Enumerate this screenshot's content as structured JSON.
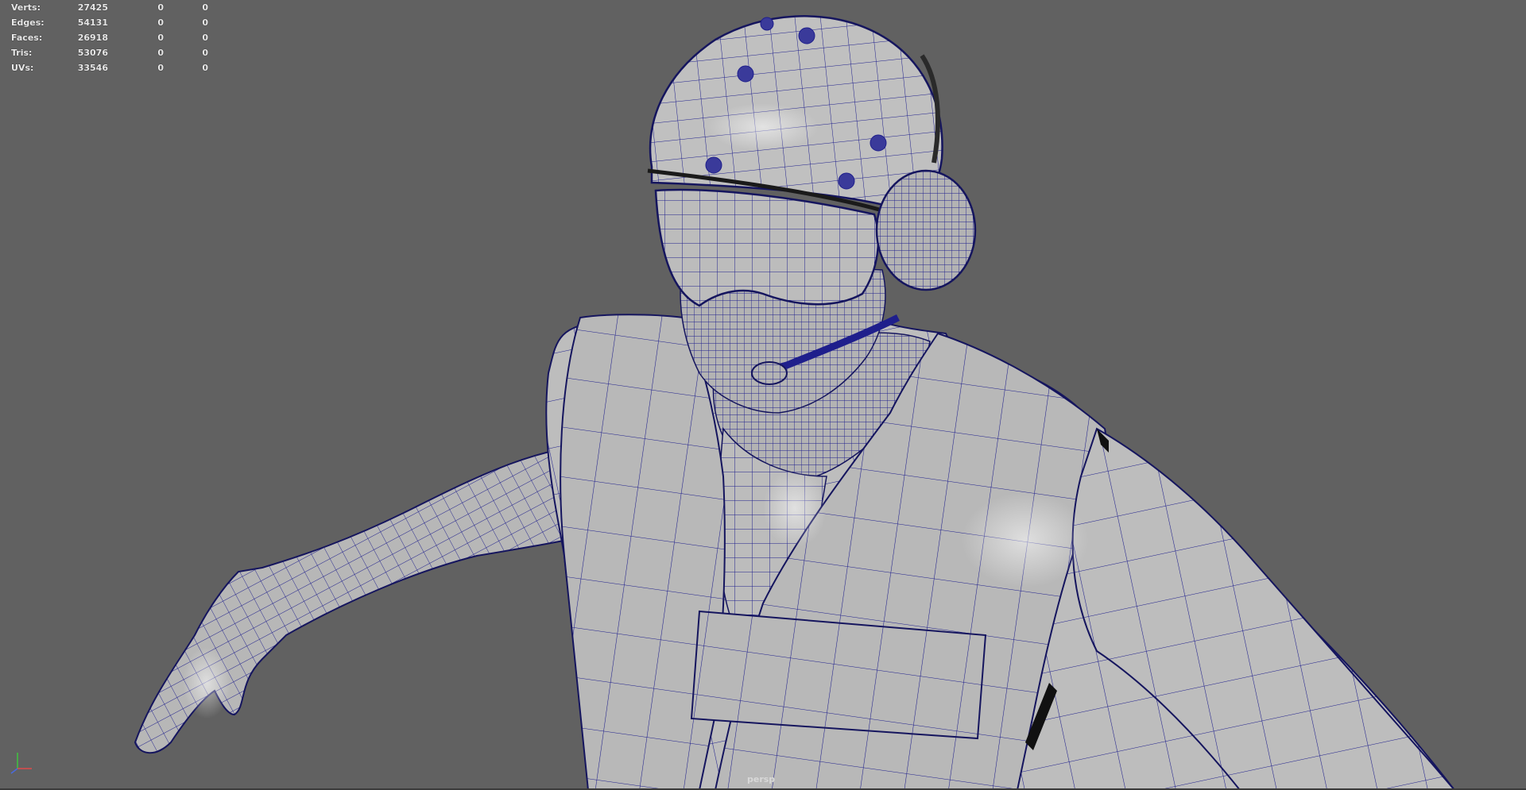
{
  "viewport": {
    "camera": "persp",
    "background": "#616161",
    "wire_color": "#1f1f8c",
    "model_color": "#b9b9b9"
  },
  "hud": {
    "rows": [
      {
        "label": "Verts:",
        "v1": "27425",
        "v2": "0",
        "v3": "0"
      },
      {
        "label": "Edges:",
        "v1": "54131",
        "v2": "0",
        "v3": "0"
      },
      {
        "label": "Faces:",
        "v1": "26918",
        "v2": "0",
        "v3": "0"
      },
      {
        "label": "Tris:",
        "v1": "53076",
        "v2": "0",
        "v3": "0"
      },
      {
        "label": "UVs:",
        "v1": "33546",
        "v2": "0",
        "v3": "0"
      }
    ]
  },
  "axis_icons": {
    "x": "x-axis-icon",
    "y": "y-axis-icon",
    "z": "z-axis-icon"
  }
}
